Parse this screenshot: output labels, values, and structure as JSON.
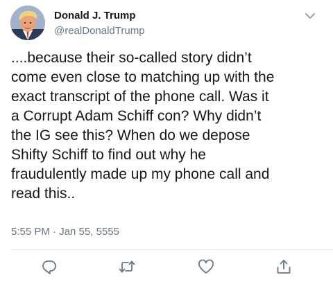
{
  "author": {
    "display_name": "Donald J. Trump",
    "handle": "@realDonaldTrump",
    "avatar_icon": "profile-avatar"
  },
  "tweet": {
    "text_lines": [
      "....because their so-called story didn’t",
      "come even close to matching up with the",
      "exact transcript of the phone call. Was it",
      "a Corrupt Adam Schiff con? Why didn’t",
      "the IG see this? When do we depose",
      "Shifty Schiff to find out why he",
      "fraudulently made up my phone call and",
      "read this.."
    ],
    "timestamp": "5:55 PM · Jan 55, 5555"
  },
  "actions": {
    "reply_icon": "reply-icon",
    "retweet_icon": "retweet-icon",
    "like_icon": "like-icon",
    "share_icon": "share-icon"
  },
  "colors": {
    "text": "#14171a",
    "secondary": "#657786",
    "icon": "#657786",
    "divider": "#e1e8ed"
  }
}
